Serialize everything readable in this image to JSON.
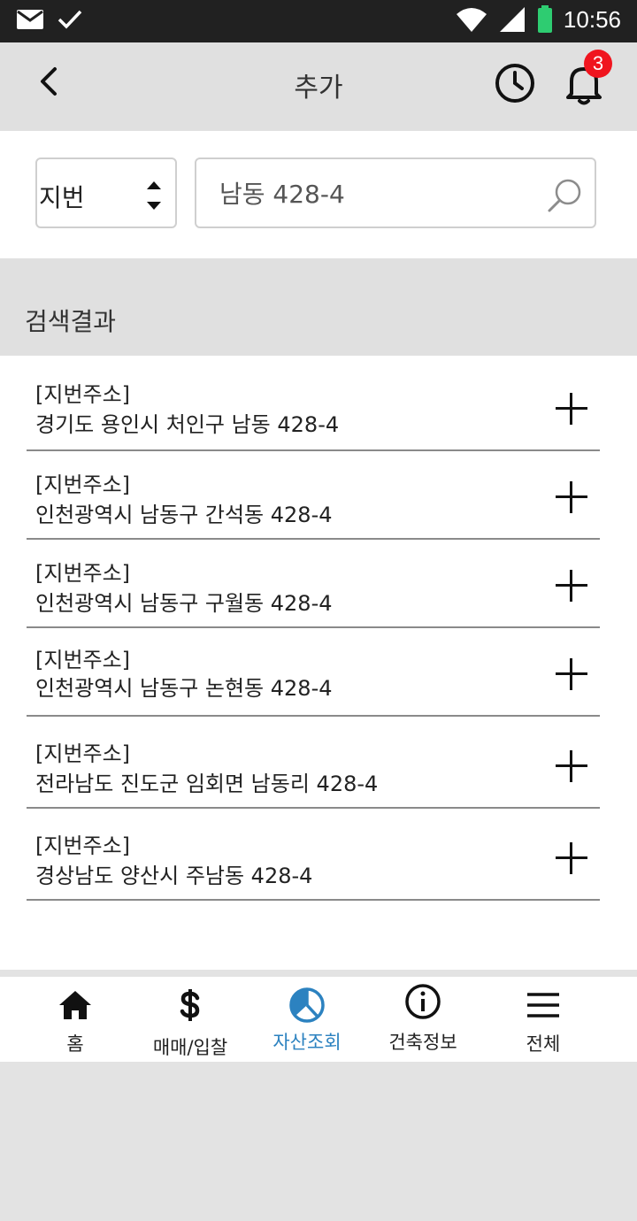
{
  "status_bar": {
    "time": "10:56"
  },
  "header": {
    "title": "추가",
    "notification_count": "3"
  },
  "search": {
    "type_selected": "지번",
    "query_value": "남동 428-4"
  },
  "results": {
    "heading": "검색결과",
    "items": [
      {
        "tag": "[지번주소]",
        "address": "경기도 용인시 처인구 남동 428-4"
      },
      {
        "tag": "[지번주소]",
        "address": "인천광역시 남동구 간석동 428-4"
      },
      {
        "tag": "[지번주소]",
        "address": "인천광역시 남동구 구월동 428-4"
      },
      {
        "tag": "[지번주소]",
        "address": "인천광역시 남동구 논현동 428-4"
      },
      {
        "tag": "[지번주소]",
        "address": "전라남도 진도군 임회면 남동리 428-4"
      },
      {
        "tag": "[지번주소]",
        "address": "경상남도 양산시 주남동 428-4"
      }
    ]
  },
  "bottom_nav": {
    "active_color": "#2c82c0",
    "items": [
      {
        "label": "홈",
        "icon": "home-icon"
      },
      {
        "label": "매매/입찰",
        "icon": "dollar-icon"
      },
      {
        "label": "자산조회",
        "icon": "pie-chart-icon"
      },
      {
        "label": "건축정보",
        "icon": "info-icon"
      },
      {
        "label": "전체",
        "icon": "menu-icon"
      }
    ]
  }
}
